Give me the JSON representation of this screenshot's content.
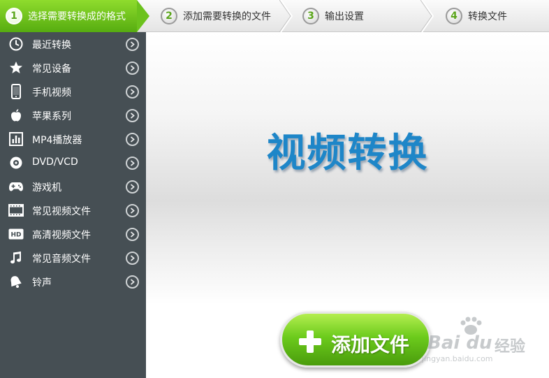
{
  "steps": [
    {
      "num": "1",
      "label": "选择需要转换成的格式",
      "active": true
    },
    {
      "num": "2",
      "label": "添加需要转换的文件",
      "active": false
    },
    {
      "num": "3",
      "label": "输出设置",
      "active": false
    },
    {
      "num": "4",
      "label": "转换文件",
      "active": false
    }
  ],
  "sidebar": {
    "items": [
      {
        "label": "最近转换",
        "icon": "clock-icon"
      },
      {
        "label": "常见设备",
        "icon": "star-icon"
      },
      {
        "label": "手机视频",
        "icon": "phone-icon"
      },
      {
        "label": "苹果系列",
        "icon": "apple-icon"
      },
      {
        "label": "MP4播放器",
        "icon": "mp4-player-icon"
      },
      {
        "label": "DVD/VCD",
        "icon": "disc-icon"
      },
      {
        "label": "游戏机",
        "icon": "gamepad-icon"
      },
      {
        "label": "常见视频文件",
        "icon": "film-icon"
      },
      {
        "label": "高清视频文件",
        "icon": "hd-icon"
      },
      {
        "label": "常见音频文件",
        "icon": "music-note-icon"
      },
      {
        "label": "铃声",
        "icon": "bell-icon"
      }
    ]
  },
  "main": {
    "title": "视频转换",
    "add_button_label": "添加文件"
  },
  "watermark": {
    "logo": "Bai du",
    "suffix": "经验",
    "url": "jingyan.baidu.com"
  },
  "colors": {
    "active_step": "#6cc21d",
    "sidebar_bg": "#464f54",
    "title_blue": "#1e86c8",
    "button_green": "#6ccb1c"
  }
}
